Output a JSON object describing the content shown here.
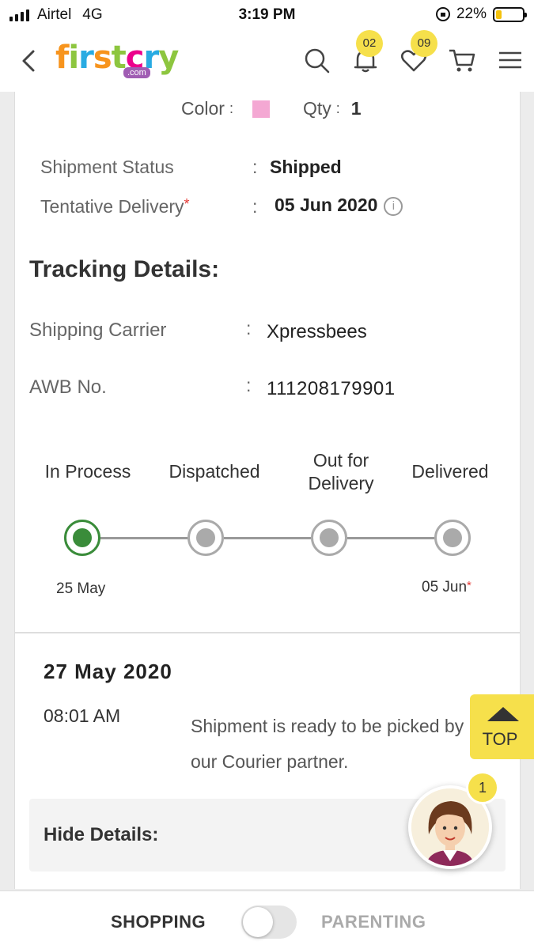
{
  "status_bar": {
    "carrier": "Airtel",
    "network": "4G",
    "time": "3:19 PM",
    "battery": "22%",
    "battery_level": 0.22
  },
  "header": {
    "logo_text": [
      "f",
      "i",
      "r",
      "s",
      "t",
      "c",
      "r",
      "y"
    ],
    "logo_sub": ".com",
    "notifications_count": "02",
    "wishlist_count": "09"
  },
  "product": {
    "color_label": "Color",
    "color_value": "#f4a8d3",
    "qty_label": "Qty",
    "qty_value": "1"
  },
  "shipment": {
    "status_label": "Shipment Status",
    "status_value": "Shipped",
    "delivery_label": "Tentative Delivery",
    "delivery_value": "05 Jun 2020",
    "info_glyph": "i"
  },
  "tracking": {
    "title": "Tracking Details:",
    "carrier_label": "Shipping Carrier",
    "carrier_value": "Xpressbees",
    "awb_label": "AWB No.",
    "awb_value": "111208179901"
  },
  "progress": {
    "steps": [
      {
        "label": "In Process",
        "active": true
      },
      {
        "label": "Dispatched",
        "active": false
      },
      {
        "label": "Out for\nDelivery",
        "active": false
      },
      {
        "label": "Delivered",
        "active": false
      }
    ],
    "start_date": "25 May",
    "end_date": "05 Jun"
  },
  "log": {
    "date": "27 May 2020",
    "time": "08:01 AM",
    "message": "Shipment is ready to be picked by our Courier partner."
  },
  "hide_details_label": "Hide Details:",
  "top_button": "TOP",
  "chat_badge": "1",
  "bottom_bar": {
    "shopping": "SHOPPING",
    "parenting": "PARENTING"
  },
  "required_mark": "*",
  "colon": ":"
}
